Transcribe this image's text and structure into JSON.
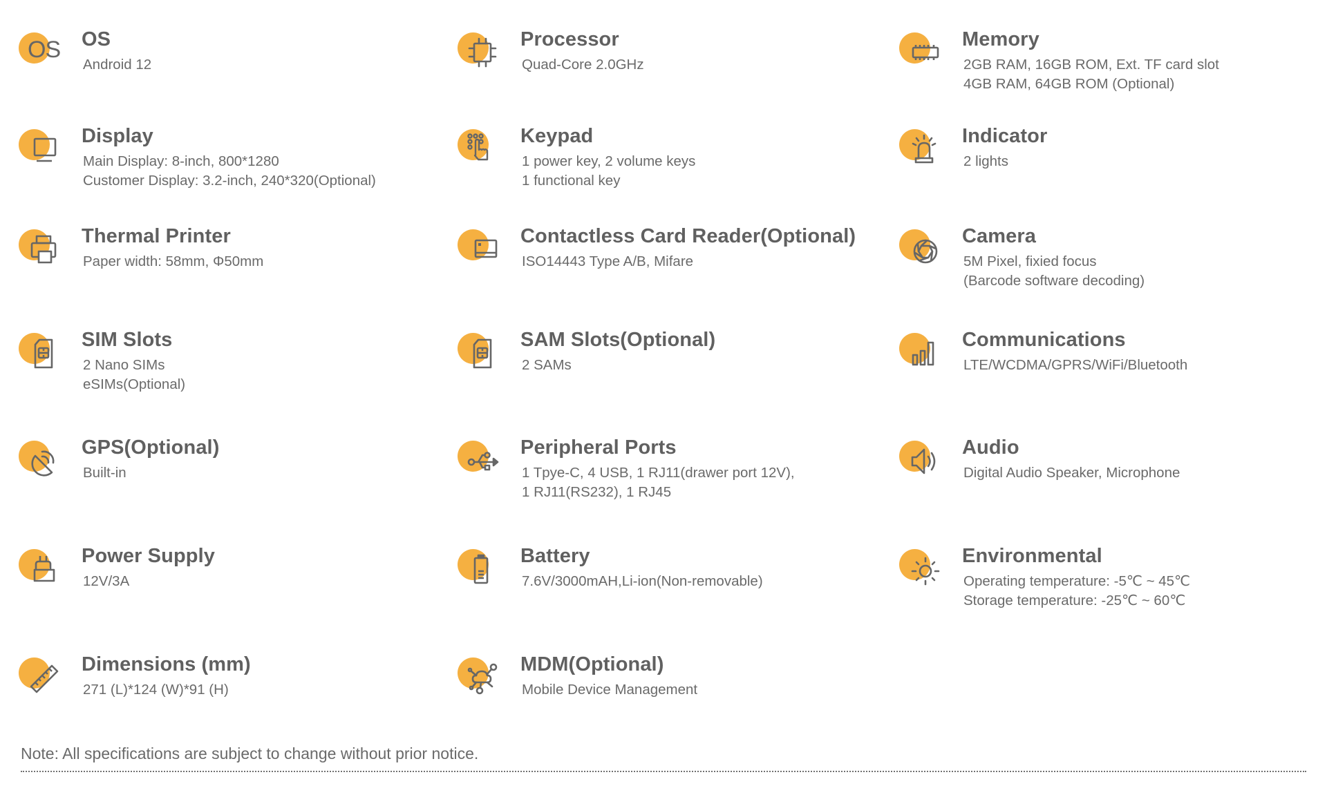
{
  "accent_color": "#F5B041",
  "icon_color": "#666666",
  "columns": [
    {
      "items": [
        {
          "icon": "os-text-icon",
          "title": "OS",
          "lines": [
            "Android 12"
          ]
        },
        {
          "icon": "monitor-icon",
          "title": "Display",
          "lines": [
            "Main Display: 8-inch, 800*1280",
            "Customer Display: 3.2-inch, 240*320(Optional)"
          ]
        },
        {
          "icon": "printer-icon",
          "title": "Thermal Printer",
          "lines": [
            "Paper width: 58mm, Φ50mm"
          ]
        },
        {
          "icon": "sim-card-icon",
          "title": "SIM Slots",
          "lines": [
            "2 Nano SIMs",
            "eSIMs(Optional)"
          ]
        },
        {
          "icon": "satellite-dish-icon",
          "title": "GPS(Optional)",
          "lines": [
            "Built-in"
          ]
        },
        {
          "icon": "power-plug-icon",
          "title": "Power Supply",
          "lines": [
            "12V/3A"
          ]
        },
        {
          "icon": "ruler-icon",
          "title": "Dimensions (mm)",
          "lines": [
            "271 (L)*124 (W)*91 (H)"
          ]
        }
      ]
    },
    {
      "items": [
        {
          "icon": "cpu-chip-icon",
          "title": "Processor",
          "lines": [
            "Quad-Core 2.0GHz"
          ]
        },
        {
          "icon": "keypad-touch-icon",
          "title": "Keypad",
          "lines": [
            "1 power key, 2 volume keys",
            "1 functional key"
          ]
        },
        {
          "icon": "card-icon",
          "title": "Contactless Card Reader(Optional)",
          "lines": [
            "ISO14443 Type A/B, Mifare"
          ]
        },
        {
          "icon": "sam-card-icon",
          "title": "SAM Slots(Optional)",
          "lines": [
            "2 SAMs"
          ]
        },
        {
          "icon": "usb-icon",
          "title": "Peripheral Ports",
          "lines": [
            "1 Tpye-C, 4 USB, 1 RJ11(drawer port 12V),",
            "1 RJ11(RS232), 1 RJ45"
          ]
        },
        {
          "icon": "battery-icon",
          "title": "Battery",
          "lines": [
            "7.6V/3000mAH,Li-ion(Non-removable)"
          ]
        },
        {
          "icon": "cloud-network-icon",
          "title": "MDM(Optional)",
          "lines": [
            "Mobile Device Management"
          ]
        }
      ]
    },
    {
      "items": [
        {
          "icon": "memory-module-icon",
          "title": "Memory",
          "lines": [
            "2GB RAM, 16GB ROM, Ext. TF card slot",
            "4GB RAM, 64GB ROM (Optional)"
          ]
        },
        {
          "icon": "siren-light-icon",
          "title": "Indicator",
          "lines": [
            "2 lights"
          ]
        },
        {
          "icon": "camera-aperture-icon",
          "title": "Camera",
          "lines": [
            "5M Pixel, fixied focus",
            "(Barcode software decoding)"
          ]
        },
        {
          "icon": "signal-bars-icon",
          "title": "Communications",
          "lines": [
            "LTE/WCDMA/GPRS/WiFi/Bluetooth"
          ]
        },
        {
          "icon": "speaker-icon",
          "title": "Audio",
          "lines": [
            "Digital Audio Speaker, Microphone"
          ]
        },
        {
          "icon": "sun-icon",
          "title": "Environmental",
          "lines": [
            "Operating temperature: -5℃ ~ 45℃",
            "Storage temperature: -25℃ ~ 60℃"
          ]
        }
      ]
    }
  ],
  "os_icon_text": "OS",
  "note": "Note: All specifications are subject to change without prior notice."
}
